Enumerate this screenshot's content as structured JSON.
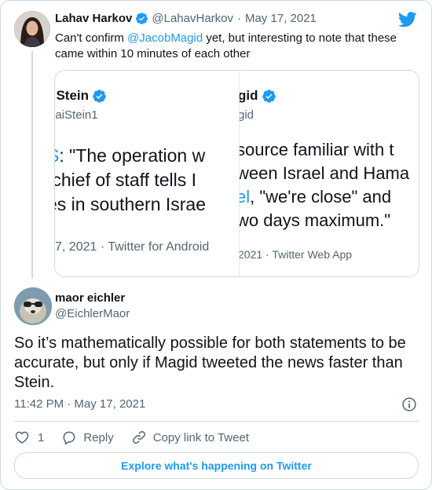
{
  "parent_tweet": {
    "author_name": "Lahav Harkov",
    "author_handle": "@LahavHarkov",
    "date": "May 17, 2021",
    "separator": "·",
    "text_prefix": "Can't confirm ",
    "mention": "@JacobMagid",
    "text_suffix": " yet, but interesting to note that these came within 10 minutes of each other"
  },
  "quoted_images": {
    "left": {
      "name": "i Stein",
      "handle": "naiStein1",
      "line1_highlight": "S",
      "line1_rest": ": \"The operation w",
      "line2": " chief of staff tells I",
      "line3": "es in southern Israe",
      "meta": "7, 2021 · Twitter for Android"
    },
    "right": {
      "name": "gid",
      "handle": "gid",
      "line1": "source familiar with t",
      "line2": "ween Israel and Hama",
      "line3_highlight": "el",
      "line3_rest": ", \"we're close\" and",
      "line4": "wo days maximum.\"",
      "meta": "2021 · Twitter Web App"
    }
  },
  "main_tweet": {
    "author_name": "maor eichler",
    "author_handle": "@EichlerMaor",
    "text": "So it’s mathematically possible for both statements to be accurate, but only if Magid tweeted the news faster than Stein.",
    "timestamp": "11:42 PM · May 17, 2021"
  },
  "actions": {
    "like_count": "1",
    "reply_label": "Reply",
    "copy_link_label": "Copy link to Tweet"
  },
  "explore_label": "Explore what's happening on Twitter",
  "colors": {
    "brand": "#1d9bf0",
    "text": "#0f1419",
    "muted": "#536471",
    "border": "#cfd9de"
  },
  "icons": [
    "verified-badge-icon",
    "twitter-bird-icon",
    "info-icon",
    "heart-icon",
    "reply-bubble-icon",
    "link-icon"
  ]
}
